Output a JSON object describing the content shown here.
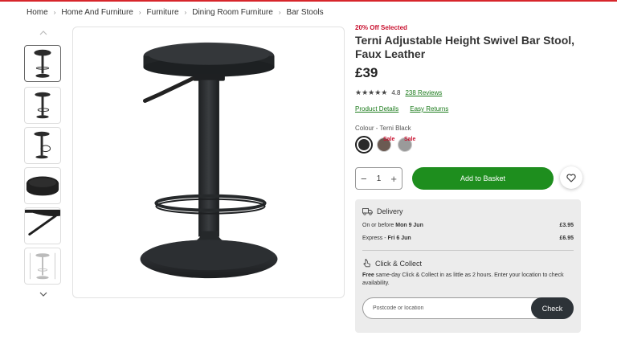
{
  "breadcrumb": [
    {
      "label": "Home"
    },
    {
      "label": "Home And Furniture"
    },
    {
      "label": "Furniture"
    },
    {
      "label": "Dining Room Furniture"
    },
    {
      "label": "Bar Stools"
    }
  ],
  "product": {
    "promo": "20% Off Selected",
    "title_line1": "Terni Adjustable Height Swivel Bar Stool,",
    "title_line2": "Faux Leather",
    "price": "£39",
    "stars": "★★★★★",
    "rating": 4.8,
    "rating_text": "4.8",
    "reviews_link": "238 Reviews",
    "product_details_link": "Product Details",
    "easy_returns_link": "Easy Returns",
    "colour_label": "Colour - Terni Black",
    "swatches": [
      {
        "name": "Terni Black",
        "color": "#2a2a2a",
        "selected": true,
        "sale": ""
      },
      {
        "name": "Brown",
        "color": "#6b5a52",
        "selected": false,
        "sale": "Sale"
      },
      {
        "name": "Grey",
        "color": "#9a9a9a",
        "selected": false,
        "sale": "Sale"
      }
    ]
  },
  "buy": {
    "minus": "−",
    "quantity": "1",
    "plus": "+",
    "add_to_basket": "Add to Basket"
  },
  "delivery": {
    "heading": "Delivery",
    "rows": [
      {
        "label": "On or before ",
        "date": "Mon 9 Jun",
        "price": "£3.95"
      },
      {
        "label": "Express - ",
        "date": "Fri 6 Jun",
        "price": "£6.95"
      }
    ],
    "cc_heading": "Click & Collect",
    "cc_bold": "Free",
    "cc_text": " same-day Click & Collect in as little as 2 hours. Enter your location to check availability.",
    "postcode_placeholder": "Postcode or location",
    "check_label": "Check"
  },
  "colors": {
    "brand_red": "#d7262b",
    "green": "#1e8e1e",
    "link_green": "#1a7a1a",
    "dark_button": "#2d3338"
  },
  "icons": {
    "chevron_up": "chevron-up-icon",
    "chevron_down": "chevron-down-icon",
    "heart": "heart-icon",
    "delivery": "van-icon",
    "click_collect": "click-collect-icon"
  }
}
